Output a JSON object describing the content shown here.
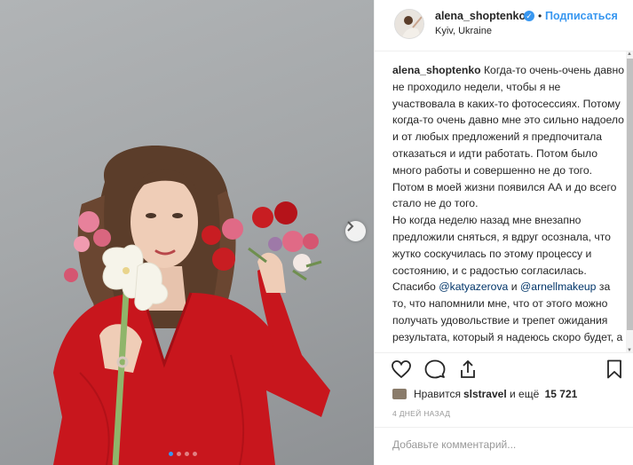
{
  "post": {
    "username": "alena_shoptenko",
    "follow_label": "Подписаться",
    "location": "Kyiv, Ukraine",
    "separator": "•",
    "verified_mark": "✓"
  },
  "caption": {
    "username": "alena_shoptenko",
    "text_1": " Когда-то очень-очень давно не проходило недели, чтобы я не участвовала в каких-то фотосессиях. Потому когда-то очень давно мне это сильно надоело и от любых предложений я предпочитала отказаться и идти работать. Потом было много работы и совершенно не до того. Потом в моей жизни появился АА и до всего стало не до того.\nНо когда неделю назад мне внезапно предложили сняться, я вдруг осознала, что жутко соскучилась по этому процессу и состоянию, и с радостью согласилась.\nСпасибо ",
    "mention_1": "@katyazerova",
    "text_2": " и ",
    "mention_2": "@arnellmakeup",
    "text_3": " за то, что напомнили мне, что от этого можно получать удовольствие и трепет ожидания результата, который я надеюсь скоро будет, а то я умру от интереса."
  },
  "likes": {
    "prefix": "Нравится ",
    "user": "slstravel",
    "middle": " и ещё ",
    "count": "15 721"
  },
  "time_ago": "4 ДНЕЙ НАЗАД",
  "comment": {
    "placeholder": "Добавьте комментарий..."
  },
  "carousel": {
    "slides": 4,
    "active": 0
  },
  "icons": {
    "like": "heart-icon",
    "comment": "comment-icon",
    "share": "share-icon",
    "save": "bookmark-icon",
    "next": "chevron-right-icon"
  },
  "colors": {
    "accent": "#3897f0",
    "dress": "#c8161d",
    "mention": "#003569"
  }
}
